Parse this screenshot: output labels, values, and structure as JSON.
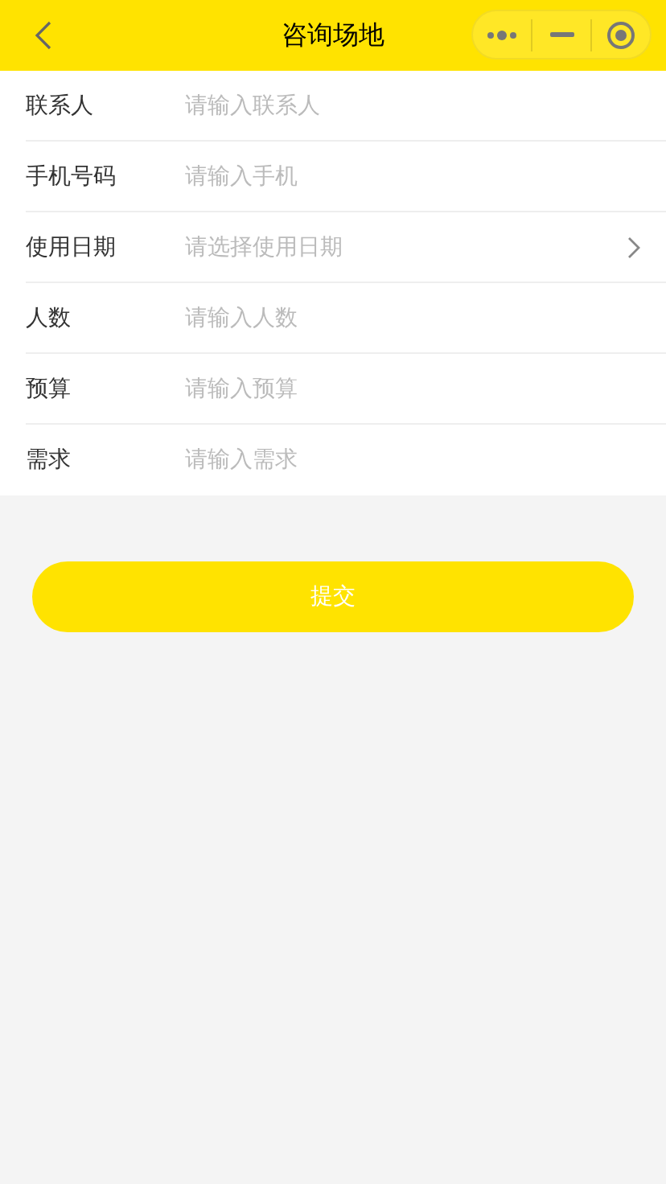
{
  "header": {
    "title": "咨询场地"
  },
  "form": {
    "fields": [
      {
        "kind": "input",
        "label": "联系人",
        "placeholder": "请输入联系人"
      },
      {
        "kind": "input",
        "label": "手机号码",
        "placeholder": "请输入手机"
      },
      {
        "kind": "picker",
        "label": "使用日期",
        "placeholder": "请选择使用日期"
      },
      {
        "kind": "input",
        "label": "人数",
        "placeholder": "请输入人数"
      },
      {
        "kind": "input",
        "label": "预算",
        "placeholder": "请输入预算"
      },
      {
        "kind": "input",
        "label": "需求",
        "placeholder": "请输入需求"
      }
    ]
  },
  "submit_button": {
    "label": "提交"
  }
}
